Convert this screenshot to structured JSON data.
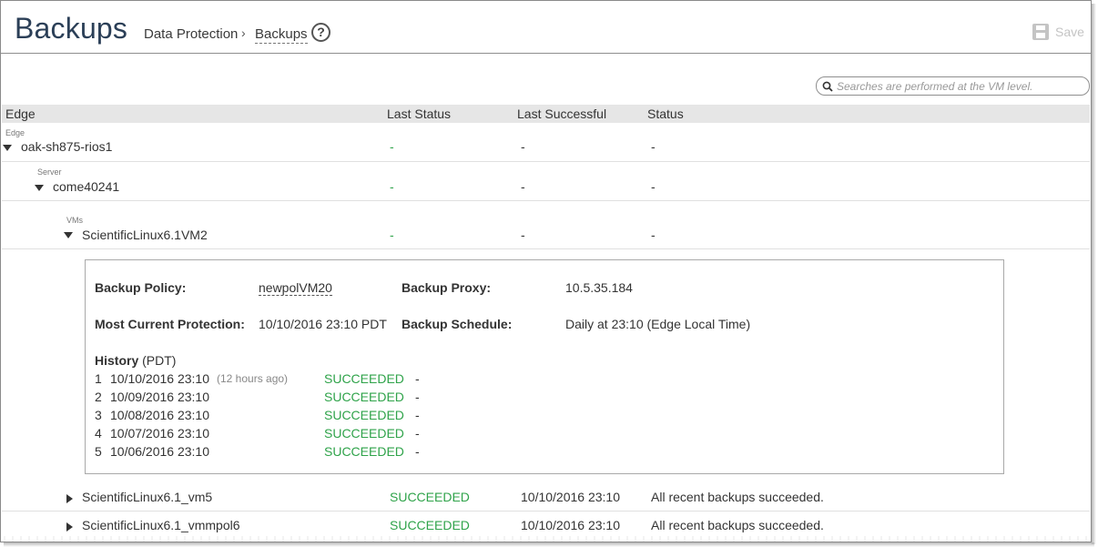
{
  "header": {
    "title": "Backups",
    "breadcrumb_parent": "Data Protection",
    "breadcrumb_sep": "›",
    "breadcrumb_current": "Backups",
    "help_glyph": "?",
    "save_label": "Save"
  },
  "search": {
    "placeholder": "Searches are performed at the VM level."
  },
  "columns": [
    "Edge",
    "Last Status",
    "Last Successful",
    "Status"
  ],
  "rows": {
    "edge": {
      "level_label": "Edge",
      "name": "oak-sh875-rios1",
      "last_status": "-",
      "last_successful": "-",
      "status": "-"
    },
    "server": {
      "level_label": "Server",
      "name": "come40241",
      "last_status": "-",
      "last_successful": "-",
      "status": "-"
    },
    "vm": {
      "level_label": "VMs",
      "name": "ScientificLinux6.1VM2",
      "last_status": "-",
      "last_successful": "-",
      "status": "-"
    },
    "vm5": {
      "name": "ScientificLinux6.1_vm5",
      "last_status": "SUCCEEDED",
      "last_successful": "10/10/2016 23:10",
      "status": "All recent backups succeeded."
    },
    "vmmpol6": {
      "name": "ScientificLinux6.1_vmmpol6",
      "last_status": "SUCCEEDED",
      "last_successful": "10/10/2016 23:10",
      "status": "All recent backups succeeded."
    }
  },
  "detail": {
    "policy_label": "Backup Policy:",
    "policy_value": "newpolVM20",
    "proxy_label": "Backup Proxy:",
    "proxy_value": "10.5.35.184",
    "protection_label": "Most Current Protection:",
    "protection_value": "10/10/2016 23:10 PDT",
    "schedule_label": "Backup Schedule:",
    "schedule_value": "Daily at 23:10 (Edge Local Time)",
    "history_label": "History",
    "history_tz": "(PDT)",
    "history": [
      {
        "n": "1",
        "date": "10/10/2016 23:10",
        "ago": "(12 hours ago)",
        "result": "SUCCEEDED",
        "note": "-"
      },
      {
        "n": "2",
        "date": "10/09/2016 23:10",
        "ago": "",
        "result": "SUCCEEDED",
        "note": "-"
      },
      {
        "n": "3",
        "date": "10/08/2016 23:10",
        "ago": "",
        "result": "SUCCEEDED",
        "note": "-"
      },
      {
        "n": "4",
        "date": "10/07/2016 23:10",
        "ago": "",
        "result": "SUCCEEDED",
        "note": "-"
      },
      {
        "n": "5",
        "date": "10/06/2016 23:10",
        "ago": "",
        "result": "SUCCEEDED",
        "note": "-"
      }
    ]
  },
  "colors": {
    "success": "#2fa34a",
    "title": "#2b3f57",
    "header_bg": "#e6e6e6"
  }
}
